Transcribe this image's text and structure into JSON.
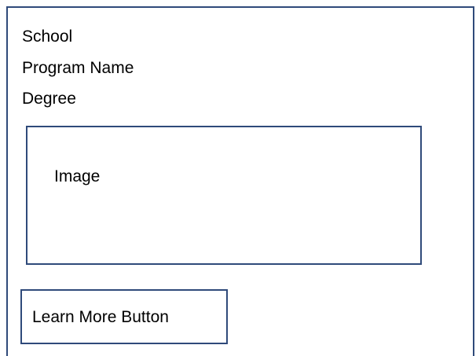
{
  "card": {
    "school_label": "School",
    "program_label": "Program Name",
    "degree_label": "Degree",
    "image_placeholder_label": "Image",
    "button_label": "Learn More Button"
  },
  "colors": {
    "border": "#2f4a7a",
    "background": "#ffffff",
    "text": "#000000"
  }
}
